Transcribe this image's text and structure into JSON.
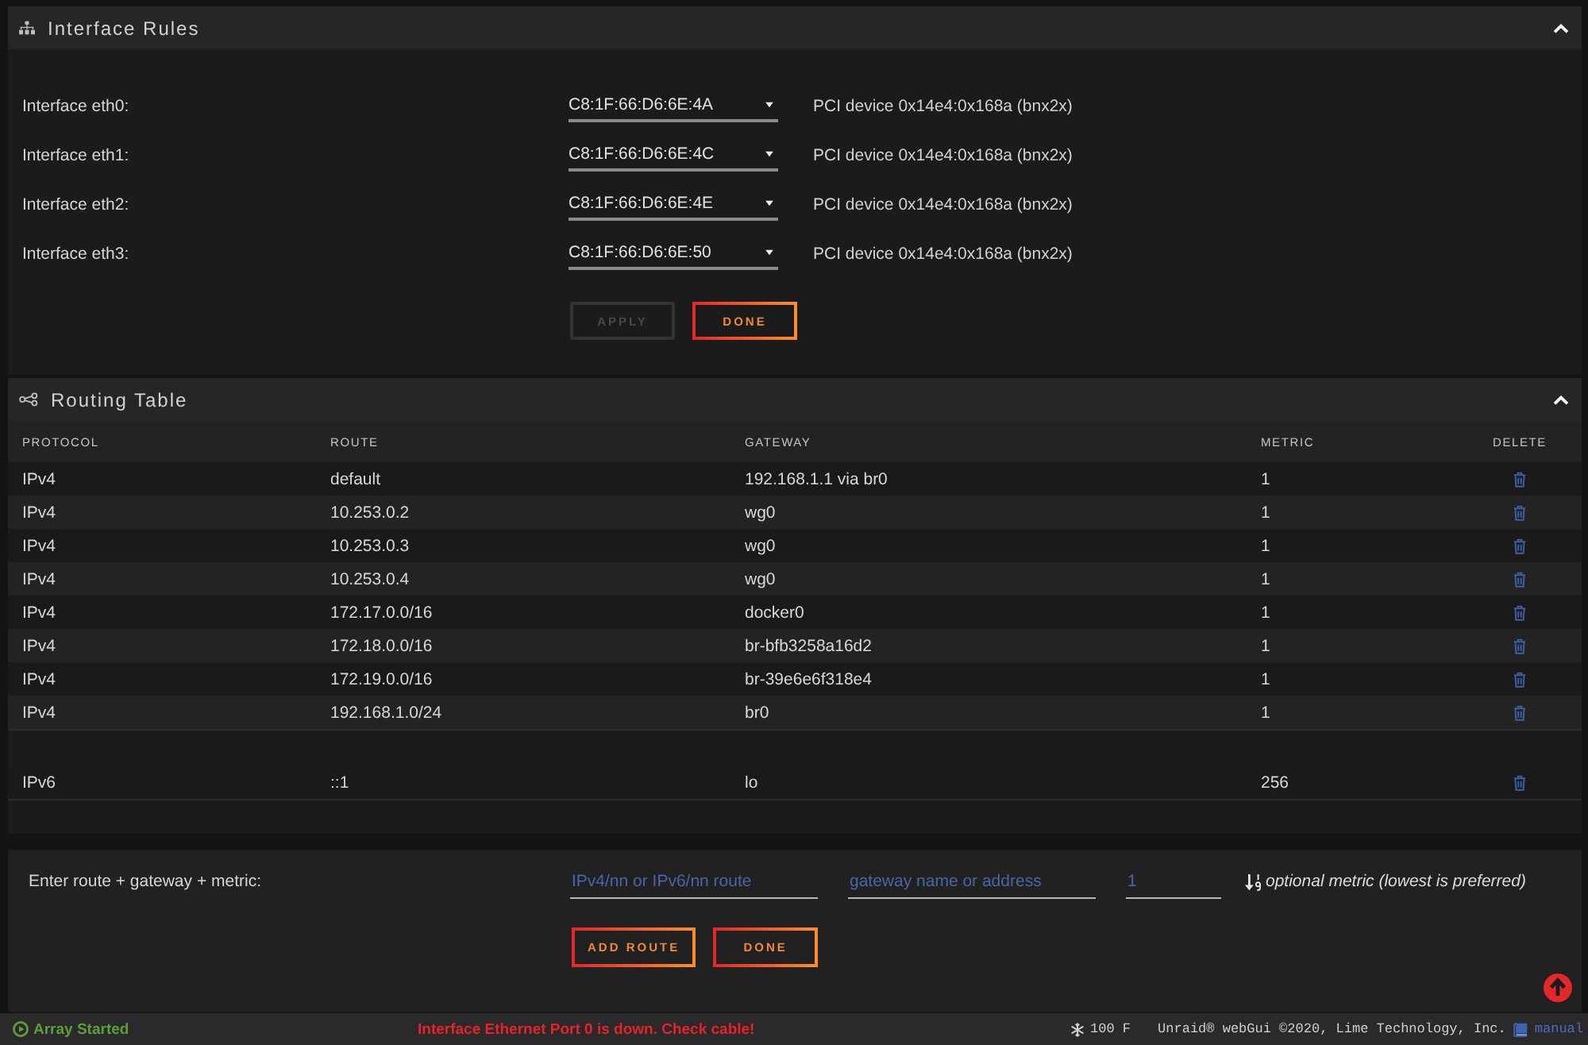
{
  "interface_rules": {
    "title": "Interface Rules",
    "expanded": true,
    "interfaces": [
      {
        "label": "Interface eth0:",
        "mac": "C8:1F:66:D6:6E:4A",
        "device": "PCI device 0x14e4:0x168a (bnx2x)"
      },
      {
        "label": "Interface eth1:",
        "mac": "C8:1F:66:D6:6E:4C",
        "device": "PCI device 0x14e4:0x168a (bnx2x)"
      },
      {
        "label": "Interface eth2:",
        "mac": "C8:1F:66:D6:6E:4E",
        "device": "PCI device 0x14e4:0x168a (bnx2x)"
      },
      {
        "label": "Interface eth3:",
        "mac": "C8:1F:66:D6:6E:50",
        "device": "PCI device 0x14e4:0x168a (bnx2x)"
      }
    ],
    "buttons": [
      {
        "label": "APPLY",
        "disabled": true
      },
      {
        "label": "DONE",
        "disabled": false
      }
    ]
  },
  "routing_table": {
    "title": "Routing Table",
    "expanded": true,
    "columns": [
      "PROTOCOL",
      "ROUTE",
      "GATEWAY",
      "METRIC",
      "DELETE"
    ],
    "groups": [
      {
        "rows": [
          {
            "protocol": "IPv4",
            "route": "default",
            "gateway": "192.168.1.1 via br0",
            "metric": "1"
          },
          {
            "protocol": "IPv4",
            "route": "10.253.0.2",
            "gateway": "wg0",
            "metric": "1"
          },
          {
            "protocol": "IPv4",
            "route": "10.253.0.3",
            "gateway": "wg0",
            "metric": "1"
          },
          {
            "protocol": "IPv4",
            "route": "10.253.0.4",
            "gateway": "wg0",
            "metric": "1"
          },
          {
            "protocol": "IPv4",
            "route": "172.17.0.0/16",
            "gateway": "docker0",
            "metric": "1"
          },
          {
            "protocol": "IPv4",
            "route": "172.18.0.0/16",
            "gateway": "br-bfb3258a16d2",
            "metric": "1"
          },
          {
            "protocol": "IPv4",
            "route": "172.19.0.0/16",
            "gateway": "br-39e6e6f318e4",
            "metric": "1"
          },
          {
            "protocol": "IPv4",
            "route": "192.168.1.0/24",
            "gateway": "br0",
            "metric": "1"
          }
        ]
      },
      {
        "rows": [
          {
            "protocol": "IPv6",
            "route": "::1",
            "gateway": "lo",
            "metric": "256"
          }
        ]
      }
    ]
  },
  "add_route": {
    "label": "Enter route + gateway + metric:",
    "route_field": {
      "placeholder": "IPv4/nn or IPv6/nn route"
    },
    "gateway_field": {
      "placeholder": "gateway name or address"
    },
    "metric_field": {
      "placeholder": "1"
    },
    "hint": "optional metric (lowest is preferred)",
    "buttons": [
      {
        "label": "ADD ROUTE",
        "disabled": false
      },
      {
        "label": "DONE",
        "disabled": false
      }
    ]
  },
  "status_bar": {
    "array_status": "Array Started",
    "alert": "Interface Ethernet Port 0 is down. Check cable!",
    "temperature": "100 F",
    "copyright": "Unraid® webGui ©2020, Lime Technology, Inc.",
    "manual_link": "manual"
  }
}
